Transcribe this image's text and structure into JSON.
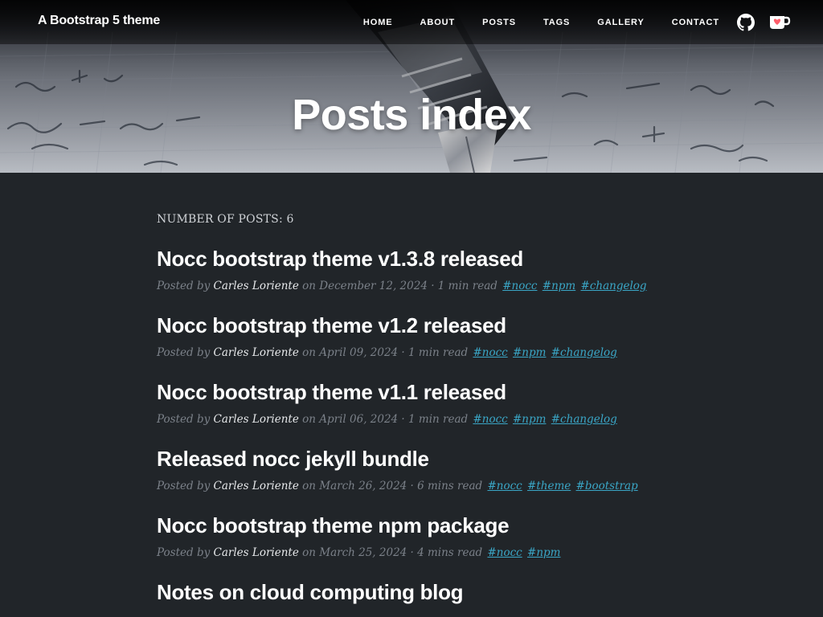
{
  "header": {
    "brand": "A Bootstrap 5 theme",
    "nav": [
      "HOME",
      "ABOUT",
      "POSTS",
      "TAGS",
      "GALLERY",
      "CONTACT"
    ],
    "icons": [
      "github-icon",
      "ko-fi-cup-icon"
    ]
  },
  "hero": {
    "title": "Posts index"
  },
  "main": {
    "count_label": "NUMBER OF POSTS: 6",
    "posts": [
      {
        "title": "Nocc bootstrap theme v1.3.8 released",
        "posted_by": "Posted by",
        "author": "Carles Loriente",
        "date": "on December 12, 2024 · 1 min read",
        "tags": [
          "#nocc",
          "#npm",
          "#changelog"
        ]
      },
      {
        "title": "Nocc bootstrap theme v1.2 released",
        "posted_by": "Posted by",
        "author": "Carles Loriente",
        "date": "on April 09, 2024 · 1 min read",
        "tags": [
          "#nocc",
          "#npm",
          "#changelog"
        ]
      },
      {
        "title": "Nocc bootstrap theme v1.1 released",
        "posted_by": "Posted by",
        "author": "Carles Loriente",
        "date": "on April 06, 2024 · 1 min read",
        "tags": [
          "#nocc",
          "#npm",
          "#changelog"
        ]
      },
      {
        "title": "Released nocc jekyll bundle",
        "posted_by": "Posted by",
        "author": "Carles Loriente",
        "date": "on March 26, 2024 · 6 mins read",
        "tags": [
          "#nocc",
          "#theme",
          "#bootstrap"
        ]
      },
      {
        "title": "Nocc bootstrap theme npm package",
        "posted_by": "Posted by",
        "author": "Carles Loriente",
        "date": "on March 25, 2024 · 4 mins read",
        "tags": [
          "#nocc",
          "#npm"
        ]
      },
      {
        "title": "Notes on cloud computing blog",
        "posted_by": "",
        "author": "",
        "date": "",
        "tags": []
      }
    ]
  },
  "colors": {
    "background": "#212529",
    "tag_link": "#3aa6c6",
    "meta_text": "#7b8189"
  }
}
